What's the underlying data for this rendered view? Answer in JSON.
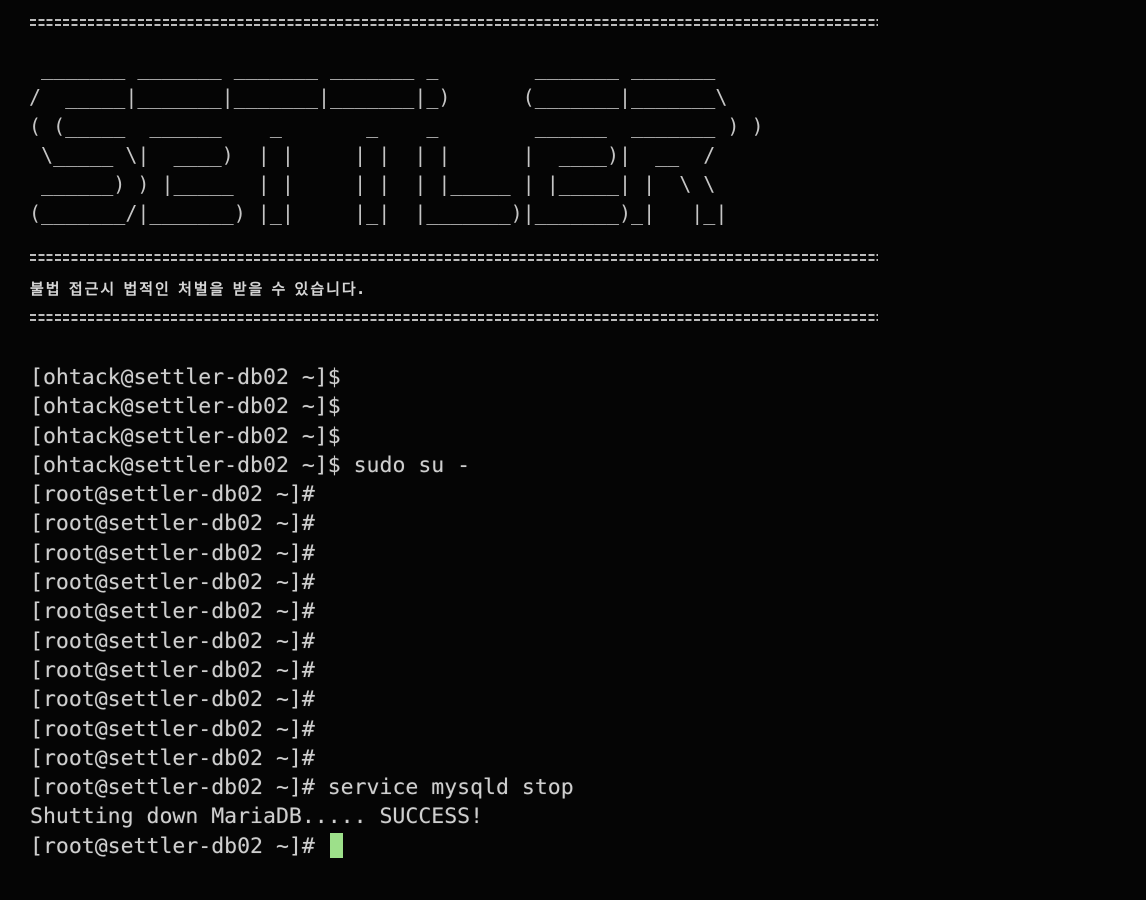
{
  "banner": {
    "ascii_logo": " _______ _______ _______ _______ _        _______ _______ \n/  _____|_______|_______|_______|_)      (_______|_______\\\n( (_____  ______    _       _    _        ______  _______ ) )\n \\_____ \\|  ____)  | |     | |  | |      |  ____)|  __  /\n ______) ) |_____  | |     | |  | |_____ | |_____| |  \\ \\\n(_______/|_______) |_|     |_|  |_______)|_______)_|   |_|",
    "warning": "불법 접근시 법적인 처벌을 받을 수 있습니다."
  },
  "terminal": {
    "cursor_color": "#9de08a",
    "lines": [
      {
        "prompt": "[ohtack@settler-db02 ~]$",
        "command": ""
      },
      {
        "prompt": "[ohtack@settler-db02 ~]$",
        "command": ""
      },
      {
        "prompt": "[ohtack@settler-db02 ~]$",
        "command": ""
      },
      {
        "prompt": "[ohtack@settler-db02 ~]$",
        "command": " sudo su -"
      },
      {
        "prompt": "[root@settler-db02 ~]#",
        "command": ""
      },
      {
        "prompt": "[root@settler-db02 ~]#",
        "command": ""
      },
      {
        "prompt": "[root@settler-db02 ~]#",
        "command": ""
      },
      {
        "prompt": "[root@settler-db02 ~]#",
        "command": ""
      },
      {
        "prompt": "[root@settler-db02 ~]#",
        "command": ""
      },
      {
        "prompt": "[root@settler-db02 ~]#",
        "command": ""
      },
      {
        "prompt": "[root@settler-db02 ~]#",
        "command": ""
      },
      {
        "prompt": "[root@settler-db02 ~]#",
        "command": ""
      },
      {
        "prompt": "[root@settler-db02 ~]#",
        "command": ""
      },
      {
        "prompt": "[root@settler-db02 ~]#",
        "command": ""
      },
      {
        "prompt": "[root@settler-db02 ~]#",
        "command": " service mysqld stop"
      },
      {
        "prompt": "Shutting down MariaDB..... SUCCESS!",
        "command": ""
      }
    ],
    "current_prompt": "[root@settler-db02 ~]# "
  }
}
